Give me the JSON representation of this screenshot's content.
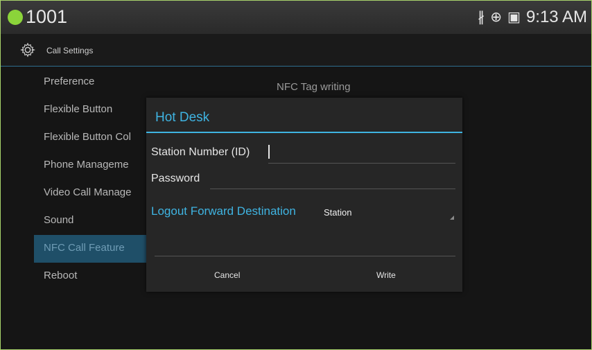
{
  "status_bar": {
    "extension": "1001",
    "icons": [
      "bluetooth-icon",
      "network-icon",
      "screen-icon"
    ],
    "time": "9:13 AM"
  },
  "title_bar": {
    "icon": "gear-icon",
    "title": "Call Settings"
  },
  "sidebar": {
    "items": [
      {
        "label": "Preference"
      },
      {
        "label": "Flexible Button"
      },
      {
        "label": "Flexible Button Col"
      },
      {
        "label": "Phone Manageme"
      },
      {
        "label": "Video Call Manage"
      },
      {
        "label": "Sound"
      },
      {
        "label": "NFC Call Feature",
        "active": true
      },
      {
        "label": "Reboot"
      }
    ]
  },
  "background_heading": "NFC Tag writing",
  "dialog": {
    "title": "Hot Desk",
    "station_number_label": "Station Number (ID)",
    "station_number_value": "",
    "password_label": "Password",
    "password_value": "",
    "logout_forward_label": "Logout Forward Destination",
    "logout_forward_value": "Station",
    "cancel_label": "Cancel",
    "write_label": "Write"
  },
  "colors": {
    "accent": "#3fb4e2",
    "status_dot": "#8bd43a",
    "active_item_bg": "#1f4f68",
    "frame_border": "#a9d46b"
  }
}
